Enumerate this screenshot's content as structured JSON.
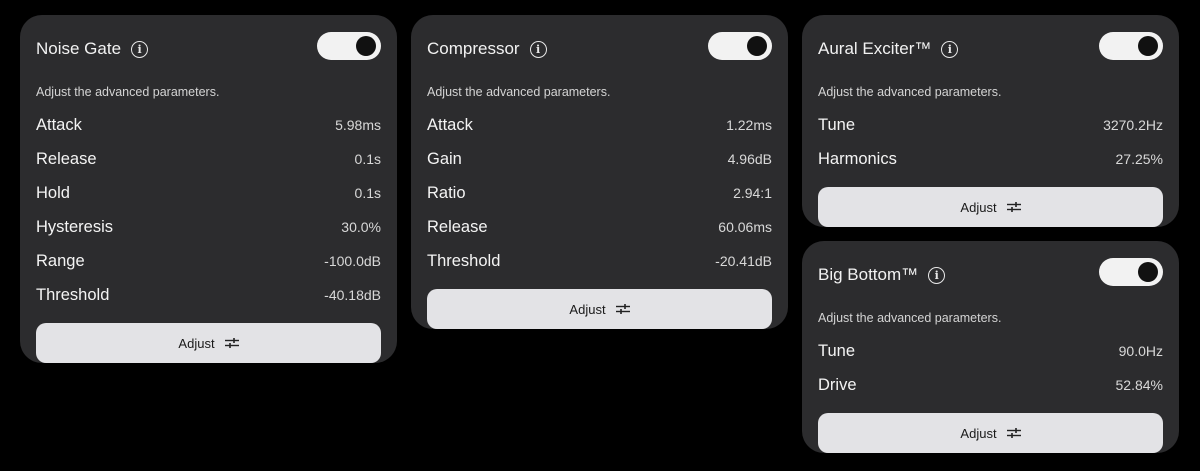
{
  "cards": [
    {
      "title": "Noise Gate",
      "subtitle": "Adjust the advanced parameters.",
      "enabled": true,
      "params": [
        {
          "name": "Attack",
          "value": "5.98ms"
        },
        {
          "name": "Release",
          "value": "0.1s"
        },
        {
          "name": "Hold",
          "value": "0.1s"
        },
        {
          "name": "Hysteresis",
          "value": "30.0%"
        },
        {
          "name": "Range",
          "value": "-100.0dB"
        },
        {
          "name": "Threshold",
          "value": "-40.18dB"
        }
      ],
      "button_label": "Adjust"
    },
    {
      "title": "Compressor",
      "subtitle": "Adjust the advanced parameters.",
      "enabled": true,
      "params": [
        {
          "name": "Attack",
          "value": "1.22ms"
        },
        {
          "name": "Gain",
          "value": "4.96dB"
        },
        {
          "name": "Ratio",
          "value": "2.94:1"
        },
        {
          "name": "Release",
          "value": "60.06ms"
        },
        {
          "name": "Threshold",
          "value": "-20.41dB"
        }
      ],
      "button_label": "Adjust"
    },
    {
      "title": "Aural Exciter™",
      "subtitle": "Adjust the advanced parameters.",
      "enabled": true,
      "params": [
        {
          "name": "Tune",
          "value": "3270.2Hz"
        },
        {
          "name": "Harmonics",
          "value": "27.25%"
        }
      ],
      "button_label": "Adjust"
    },
    {
      "title": "Big Bottom™",
      "subtitle": "Adjust the advanced parameters.",
      "enabled": true,
      "params": [
        {
          "name": "Tune",
          "value": "90.0Hz"
        },
        {
          "name": "Drive",
          "value": "52.84%"
        }
      ],
      "button_label": "Adjust"
    }
  ],
  "icons": {
    "info": "info-icon",
    "adjust": "sliders-icon"
  },
  "colors": {
    "background": "#000000",
    "card": "#2c2c2e",
    "toggle_on": "#f2f2f2",
    "button": "#e3e3e6"
  }
}
